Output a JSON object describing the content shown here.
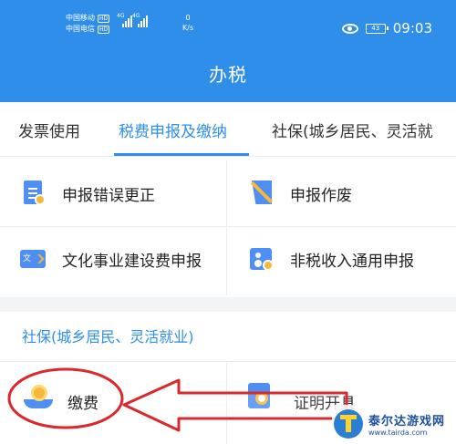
{
  "status_bar": {
    "carrier1": "中国移动",
    "carrier2": "中国电信",
    "hd": "HD",
    "net": "4G",
    "speed_value": "0",
    "speed_unit": "K/s",
    "battery": "43",
    "time": "09:03"
  },
  "header": {
    "title": "办税"
  },
  "tabs": [
    {
      "label": "发票使用"
    },
    {
      "label": "税费申报及缴纳",
      "active": true
    },
    {
      "label": "社保(城乡居民、灵活就"
    }
  ],
  "services": [
    {
      "label": "申报错误更正",
      "icon": "document-edit-icon"
    },
    {
      "label": "申报作废",
      "icon": "document-void-icon"
    },
    {
      "label": "文化事业建设费申报",
      "icon": "culture-fee-icon"
    },
    {
      "label": "非税收入通用申报",
      "icon": "non-tax-income-icon"
    }
  ],
  "social_section": {
    "title": "社保(城乡居民、灵活就业)",
    "items": [
      {
        "label": "缴费",
        "icon": "coin-hand-icon"
      },
      {
        "label": "证明开具",
        "icon": "certificate-search-icon"
      }
    ]
  },
  "annotation": {
    "color": "#d9292f"
  },
  "watermark": {
    "name": "泰尔达游戏网",
    "url": "www.tairda.com"
  },
  "colors": {
    "primary": "#2f8ee9",
    "icon_blue": "#4f8ff3",
    "icon_yellow": "#f6b83b"
  }
}
